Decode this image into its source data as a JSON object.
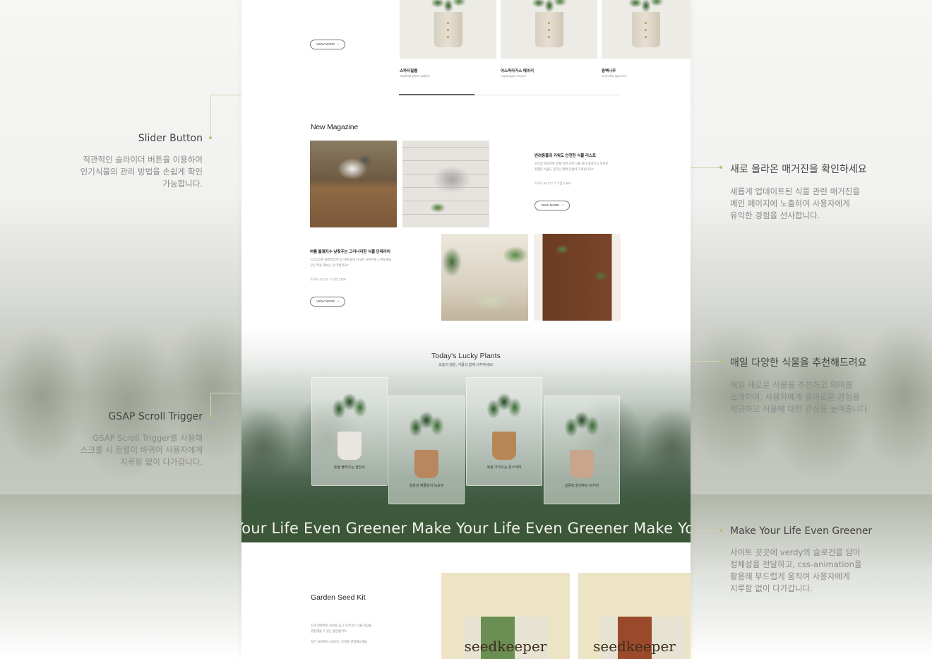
{
  "annotations": {
    "slider_button": {
      "title": "Slider Button",
      "desc": [
        "직관적인 슬라이더 버튼을 이용하여",
        "인기식물의 관리 방법을 손쉽게 확인",
        "가능합니다."
      ]
    },
    "gsap": {
      "title": "GSAP Scroll Trigger",
      "desc": [
        "GSAP Scroll Trigger를 사용해",
        "스크롤 시 정렬이 바뀌어 사용자에게",
        "지루함 없이 다가갑니다."
      ]
    },
    "magazine": {
      "title": "새로 올라온 매거진을 확인하세요",
      "desc": [
        "새롭게 업데이트된 식물 관련 매거진을",
        "메인 페이지에 노출하여 사용자에게",
        "유익한 경험을 선사합니다."
      ]
    },
    "daily": {
      "title": "매일 다양한 식물을 추천해드려요",
      "desc": [
        "매일 새로운 식물을 추천하고 의미를",
        "소개하여, 사용자에게 흥미로운 경험을",
        "제공하고 식물에 대한 관심을 높여줍니다."
      ]
    },
    "greener": {
      "title": "Make Your Life Even Greener",
      "desc": [
        "사이트 곳곳에 verdy의 슬로건을 담아",
        "정체성을 전달하고, css-animation을",
        "활용해 부드럽게 움직여 사용자에게",
        "지루함 없이 다가갑니다."
      ]
    }
  },
  "top_slider": {
    "view_more": "VIEW MORE",
    "items": [
      {
        "name": "스파티필룸",
        "sci": "Spathiphyllum wallisii"
      },
      {
        "name": "아스파라거스 메이리",
        "sci": "Asparagus meyeri"
      },
      {
        "name": "동백나무",
        "sci": "Camellia japonica"
      }
    ],
    "progress": 0.34
  },
  "magazine": {
    "title": "New Magazine",
    "articles": [
      {
        "headline": "반려동물과 키워도 안전한 식물 리스트",
        "body": [
          "우리집 멍냥이와 함께 하면 초록 식물 하나 데려오고 싶지만,",
          "위험한 식물도 있다는 말에 망설이고 계신나요?"
        ],
        "meta": "조회수 84,777  스크랩 6,303",
        "cta": "VIEW MORE"
      },
      {
        "headline": "여름 불쾌지수 낮춰주는 그리너리한 식물 인테리어",
        "body": [
          "그리너리한 플랜테리어 집 안에 들여 지구온 시원하게 느껴보세요.",
          "간단 적용 해보는 건 어떨까요?"
        ],
        "meta": "조회수 42,118  스크랩 1,800",
        "cta": "VIEW MORE"
      }
    ]
  },
  "lucky": {
    "title": "Today's Lucky Plants",
    "subtitle": "오늘의 행운, 식물과 함께 시작하세요!",
    "cards": [
      {
        "label": "돈을 불러오는 금전수",
        "pot": "#e9e6e2"
      },
      {
        "label": "행운과 재물운의 녹보수",
        "pot": "#b9875f"
      },
      {
        "label": "복을 가져오는 몬스테라",
        "pot": "#b88656"
      },
      {
        "label": "집중력 올려주는 파키라",
        "pot": "#c9a58e"
      }
    ],
    "ticker": "Your Life Even Greener   Make Your Life Even Greener   Make Your"
  },
  "seed": {
    "title": "Garden Seed Kit",
    "body": [
      "집과 텃밭에서 씨앗을 심고 자라나는 식물 성장을",
      "경험해볼 수 있는 홈텃밭키트."
    ],
    "body2": "작은 씨앗에서 시작되는 초록을 경험해보세요",
    "brand": "seedkeeper"
  },
  "colors": {
    "accent": "#c8b87a",
    "ticker": "#f2f2ee"
  }
}
